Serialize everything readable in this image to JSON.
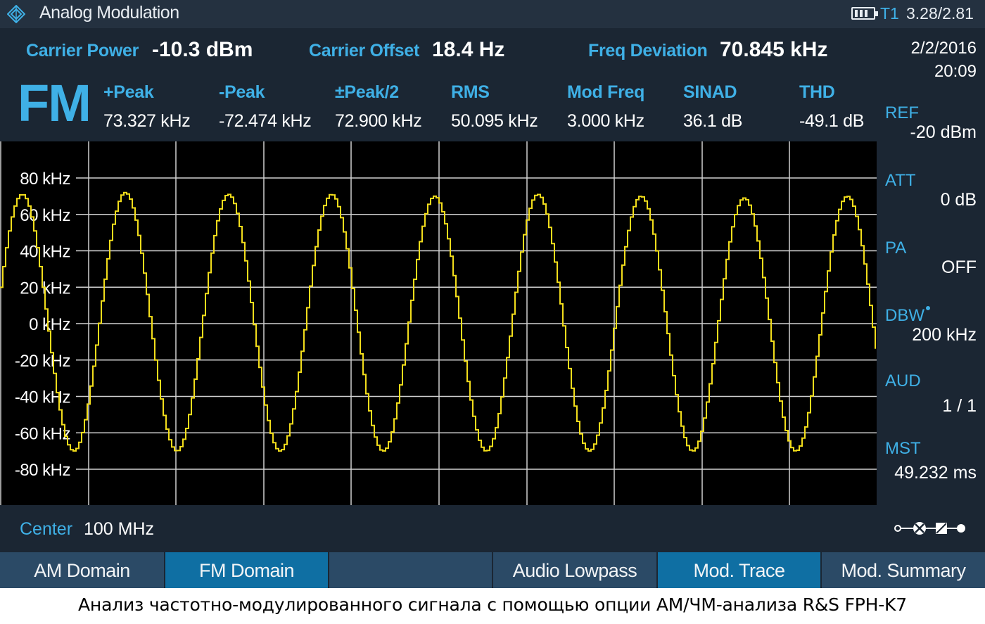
{
  "title_bar": {
    "app_title": "Analog Modulation",
    "icon": "rs-diamond-logo-icon",
    "trace_label": "T1",
    "trace_value": "3.28/2.81",
    "battery_icon": "battery-icon"
  },
  "summary": {
    "carrier_power": {
      "label": "Carrier Power",
      "value": "-10.3 dBm"
    },
    "carrier_offset": {
      "label": "Carrier Offset",
      "value": "18.4 Hz"
    },
    "freq_deviation": {
      "label": "Freq Deviation",
      "value": "70.845 kHz"
    }
  },
  "mode": "FM",
  "measurements": [
    {
      "label": "+Peak",
      "value": "73.327 kHz"
    },
    {
      "label": "-Peak",
      "value": "-72.474 kHz"
    },
    {
      "label": "±Peak/2",
      "value": "72.900 kHz"
    },
    {
      "label": "RMS",
      "value": "50.095 kHz"
    },
    {
      "label": "Mod Freq",
      "value": "3.000 kHz"
    },
    {
      "label": "SINAD",
      "value": "36.1 dB"
    },
    {
      "label": "THD",
      "value": "-49.1 dB"
    }
  ],
  "side_panel": {
    "date": "2/2/2016",
    "time": "20:09",
    "items": [
      {
        "label": "REF",
        "value": "-20 dBm"
      },
      {
        "label": "ATT",
        "value": "0 dB"
      },
      {
        "label": "PA",
        "value": "OFF"
      },
      {
        "label": "DBW",
        "value": "200 kHz"
      },
      {
        "label": "AUD",
        "value": "1 / 1"
      },
      {
        "label": "MST",
        "value": "49.232 ms"
      }
    ],
    "connector_icon": "signal-path-icon"
  },
  "footer": {
    "center_label": "Center",
    "center_value": "100 MHz"
  },
  "softkeys": [
    {
      "label": "AM Domain",
      "state": "inactive"
    },
    {
      "label": "FM Domain",
      "state": "active"
    },
    {
      "label": "",
      "state": "inactive"
    },
    {
      "label": "Audio Lowpass",
      "state": "inactive"
    },
    {
      "label": "Mod. Trace",
      "state": "active"
    },
    {
      "label": "Mod. Summary",
      "state": "inactive"
    }
  ],
  "chart_data": {
    "type": "line",
    "title": "",
    "xlabel": "",
    "ylabel": "",
    "y_ticks": [
      "80 kHz",
      "60 kHz",
      "40 kHz",
      "20 kHz",
      "0 kHz",
      "-20 kHz",
      "-40 kHz",
      "-60 kHz",
      "-80 kHz"
    ],
    "ylim": [
      -90,
      90
    ],
    "y_unit": "kHz",
    "x_divisions": 10,
    "grid": true,
    "trace_color": "#f2dd1b",
    "series": [
      {
        "waveform": "sine",
        "amplitude_khz": 71,
        "mod_freq_khz": 3.0,
        "cycles_visible": 8.5,
        "peaks_khz": [
          71,
          72,
          71,
          71,
          70,
          71,
          70,
          69,
          70
        ],
        "troughs_khz": [
          -70,
          -70,
          -70,
          -70,
          -70,
          -70,
          -70,
          -70
        ]
      }
    ]
  },
  "caption": "Анализ частотно-модулированного сигнала с помощью опции АМ/ЧМ-анализа R&S FPH-K7",
  "colors": {
    "panel_bg": "#1b2633",
    "accent": "#3fb0e6",
    "plot_bg": "#000000",
    "grid": "#d0d0d0",
    "trace": "#f2dd1b",
    "softkey_active": "#0f6fa3",
    "softkey_inactive": "#2b4a66"
  }
}
